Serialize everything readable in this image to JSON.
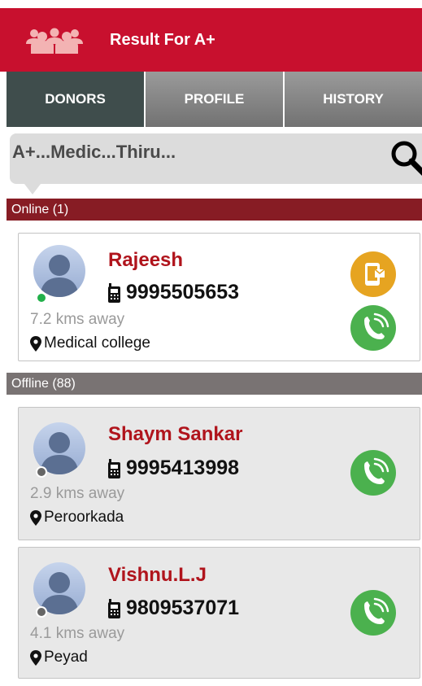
{
  "header": {
    "title": "Result For A+"
  },
  "tabs": [
    {
      "label": "DONORS",
      "active": true
    },
    {
      "label": "PROFILE",
      "active": false
    },
    {
      "label": "HISTORY",
      "active": false
    }
  ],
  "search": {
    "query": "A+...Medic...Thiru..."
  },
  "sections": {
    "online": {
      "label": "Online (1)"
    },
    "offline": {
      "label": "Offline (88)"
    }
  },
  "donors": [
    {
      "name": "Rajeesh",
      "phone": "9995505653",
      "distance": "7.2 kms away",
      "location": "Medical college",
      "status": "online"
    },
    {
      "name": "Shaym Sankar",
      "phone": "9995413998",
      "distance": "2.9 kms away",
      "location": "Peroorkada",
      "status": "offline"
    },
    {
      "name": "Vishnu.L.J",
      "phone": "9809537071",
      "distance": "4.1 kms away",
      "location": "Peyad",
      "status": "offline"
    }
  ],
  "colors": {
    "header": "#c8102e",
    "active_tab": "#3f4d4c",
    "online_section": "#871c24",
    "offline_section": "#797373",
    "donor_name": "#b0141c",
    "sms_button": "#e6a421",
    "call_button": "#4bb14e",
    "online_dot": "#22b04a"
  },
  "icons": [
    "group-logo-icon",
    "search-icon",
    "mobile-phone-icon",
    "location-pin-icon",
    "sms-icon",
    "call-icon",
    "avatar-placeholder-icon"
  ]
}
